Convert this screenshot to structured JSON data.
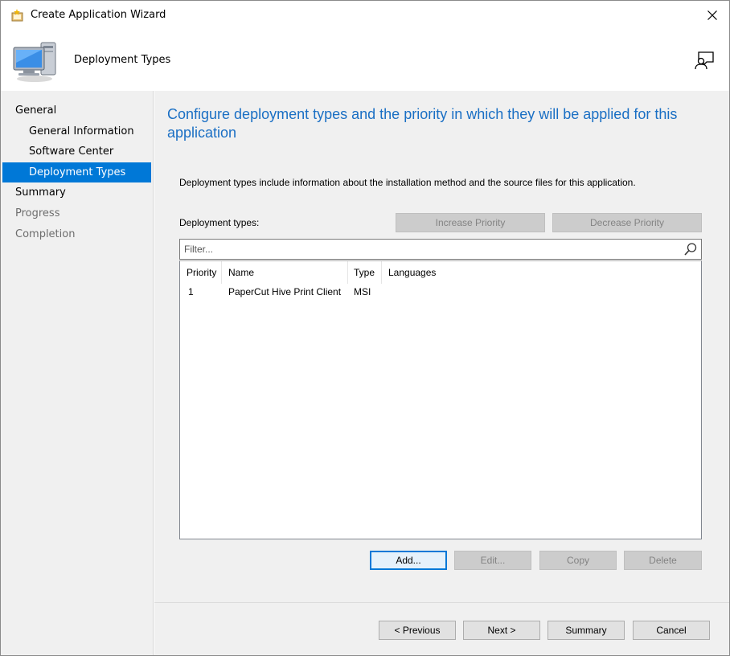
{
  "window": {
    "title": "Create Application Wizard",
    "header_title": "Deployment Types"
  },
  "sidebar": {
    "items": [
      {
        "label": "General",
        "level": 0,
        "state": "normal"
      },
      {
        "label": "General Information",
        "level": 1,
        "state": "normal"
      },
      {
        "label": "Software Center",
        "level": 1,
        "state": "normal"
      },
      {
        "label": "Deployment Types",
        "level": 1,
        "state": "selected"
      },
      {
        "label": "Summary",
        "level": 0,
        "state": "normal"
      },
      {
        "label": "Progress",
        "level": 0,
        "state": "disabled"
      },
      {
        "label": "Completion",
        "level": 0,
        "state": "disabled"
      }
    ]
  },
  "main": {
    "heading": "Configure deployment types and the priority in which they will be applied for this application",
    "intro": "Deployment types include information about the installation method and the source files for this application.",
    "deployment_types_label": "Deployment types:",
    "increase_priority": "Increase Priority",
    "decrease_priority": "Decrease Priority",
    "filter_placeholder": "Filter...",
    "columns": [
      "Priority",
      "Name",
      "Type",
      "Languages"
    ],
    "rows": [
      {
        "priority": "1",
        "name": "PaperCut Hive Print Client",
        "type": "MSI",
        "languages": ""
      }
    ],
    "add": "Add...",
    "edit": "Edit...",
    "copy": "Copy",
    "delete": "Delete"
  },
  "footer": {
    "previous": "< Previous",
    "next": "Next >",
    "summary": "Summary",
    "cancel": "Cancel"
  },
  "colors": {
    "accent": "#0078d7",
    "heading": "#1a6fc4",
    "panel": "#f0f0f0"
  }
}
